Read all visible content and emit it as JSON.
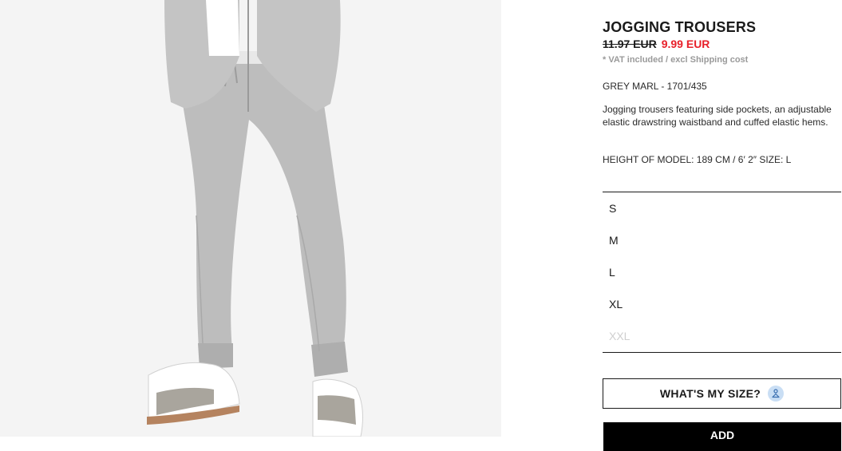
{
  "product": {
    "title": "JOGGING TROUSERS",
    "old_price": "11.97 EUR",
    "new_price": "9.99 EUR",
    "vat_note": "* VAT included / excl Shipping cost",
    "color_ref": "GREY MARL - 1701/435",
    "description": "Jogging trousers featuring side pockets, an adjustable elastic drawstring waistband and cuffed elastic hems.",
    "model_height": "HEIGHT OF MODEL: 189 CM / 6′ 2″ SIZE: L"
  },
  "sizes": [
    {
      "label": "S",
      "available": true
    },
    {
      "label": "M",
      "available": true
    },
    {
      "label": "L",
      "available": true
    },
    {
      "label": "XL",
      "available": true
    },
    {
      "label": "XXL",
      "available": false
    }
  ],
  "size_guide": {
    "label": "WHAT'S MY SIZE?",
    "icon": "person-hanger-icon"
  },
  "add_button": {
    "label": "ADD"
  },
  "colors": {
    "sale_price": "#e8202a",
    "muted": "#9a9a9a",
    "size_icon_bg": "#c9def4",
    "disabled": "#cfcfcf"
  }
}
